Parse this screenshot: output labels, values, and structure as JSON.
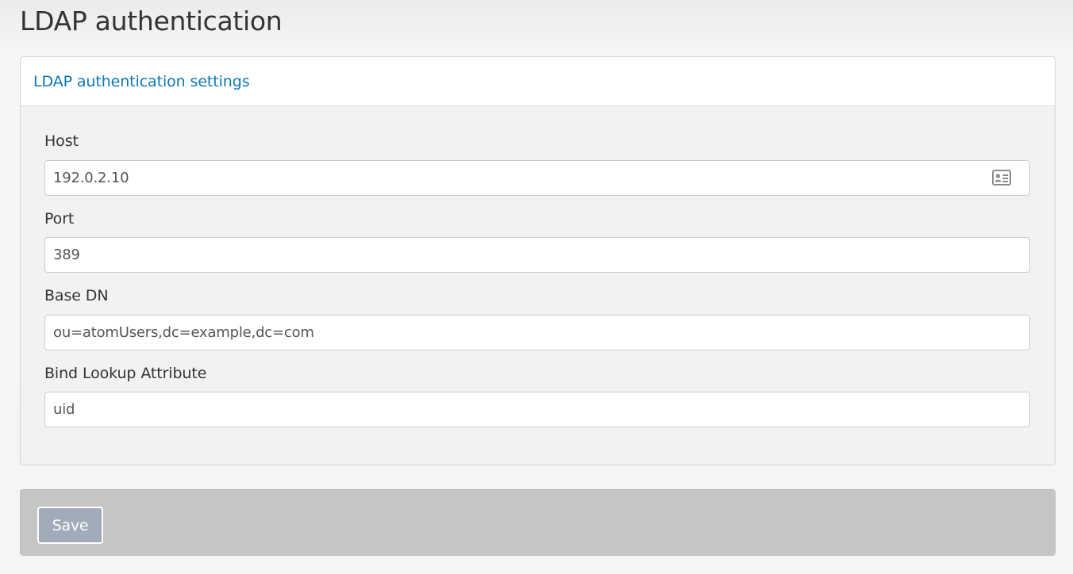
{
  "page": {
    "title": "LDAP authentication"
  },
  "panel": {
    "heading": "LDAP authentication settings"
  },
  "fields": {
    "host": {
      "label": "Host",
      "value": "192.0.2.10",
      "icon": "contact-card-icon"
    },
    "port": {
      "label": "Port",
      "value": "389"
    },
    "base_dn": {
      "label": "Base DN",
      "value": "ou=atomUsers,dc=example,dc=com"
    },
    "bind_lookup_attribute": {
      "label": "Bind Lookup Attribute",
      "value": "uid"
    }
  },
  "actions": {
    "save_label": "Save"
  },
  "colors": {
    "link": "#0b77b7",
    "panel_body": "#f2f2f2",
    "footer_bar": "#c5c5c5",
    "save_button": "#a1abba"
  }
}
